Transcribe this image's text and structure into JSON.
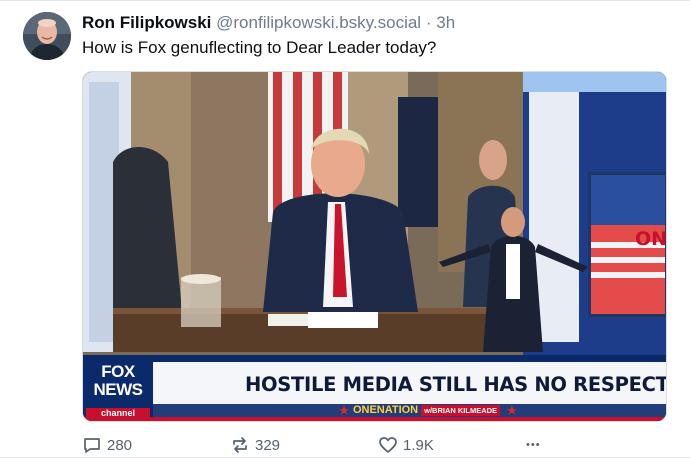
{
  "post": {
    "author": {
      "display_name": "Ron Filipkowski",
      "handle": "@ronfilipkowski.bsky.social",
      "separator": "·",
      "time": "3h"
    },
    "text": "How is Fox genuflecting to Dear Leader today?",
    "media": {
      "chyron_headline": "HOSTILE MEDIA STILL HAS NO RESPECT FOR THE OFFICE",
      "chyron_show": "ONENATION",
      "chyron_host": "w/BRIAN KILMEADE",
      "logo_line1": "FOX",
      "logo_line2": "NEWS",
      "logo_line3": "channel",
      "set_sign": "ONE"
    },
    "actions": {
      "replies": "280",
      "reposts": "329",
      "likes": "1.9K",
      "more": "•••"
    }
  },
  "icons": {
    "reply": "speech-bubble-icon",
    "repost": "repost-arrows-icon",
    "like": "heart-icon",
    "more": "ellipsis-icon"
  },
  "colors": {
    "text": "#0b0f14",
    "muted": "#6f7c8a",
    "action": "#56626f",
    "fox_blue": "#0b2a6b",
    "fox_red": "#c8102e"
  }
}
